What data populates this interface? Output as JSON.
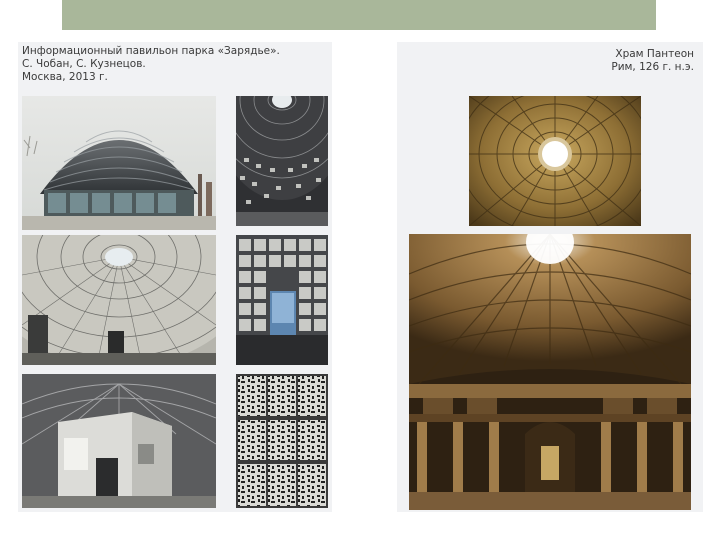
{
  "left_caption": {
    "line1": "Информационный павильон парка «Зарядье».",
    "line2": "С. Чобан, С. Кузнецов.",
    "line3": "Москва, 2013 г."
  },
  "right_caption": {
    "line1": "Храм Пантеон",
    "line2": "Рим, 126 г. н.э."
  },
  "colors": {
    "title_bar": "#a9b79a",
    "panel_background": "#f1f2f4"
  }
}
